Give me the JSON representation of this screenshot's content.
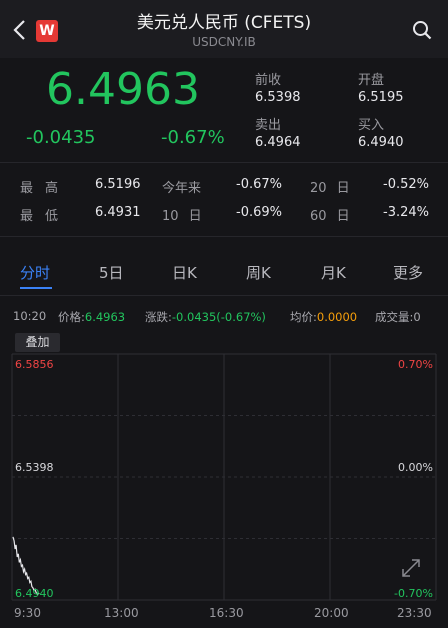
{
  "header": {
    "logo_text": "W",
    "title": "美元兑人民币 (CFETS)",
    "subtitle": "USDCNY.IB"
  },
  "quote": {
    "price": "6.4963",
    "change": "-0.0435",
    "change_pct": "-0.67%",
    "prev_close_label": "前收",
    "prev_close": "6.5398",
    "open_label": "开盘",
    "open": "6.5195",
    "ask_label": "卖出",
    "ask": "6.4964",
    "bid_label": "买入",
    "bid": "6.4940",
    "color_down": "#22c55e"
  },
  "stats": {
    "high_label": "最高",
    "high": "6.5196",
    "ytd_label": "今年来",
    "ytd": "-0.67%",
    "d20_label": "20 日",
    "d20": "-0.52%",
    "low_label": "最低",
    "low": "6.4931",
    "d10_label": "10 日",
    "d10": "-0.69%",
    "d60_label": "60 日",
    "d60": "-3.24%"
  },
  "tabs": [
    "分时",
    "5日",
    "日K",
    "周K",
    "月K",
    "更多"
  ],
  "active_tab": 0,
  "infobar": {
    "time": "10:20",
    "price_label": "价格:",
    "price": "6.4963",
    "change_label": "涨跌:",
    "change": "-0.0435(-0.67%)",
    "avg_label": "均价:",
    "avg": "0.0000",
    "volume_label": "成交量:",
    "volume": "0"
  },
  "overlay_label": "叠加",
  "chart_axis": {
    "top_price": "6.5856",
    "mid_price": "6.5398",
    "bottom_price": "6.4940",
    "top_pct": "0.70%",
    "mid_pct": "0.00%",
    "bottom_pct": "-0.70%",
    "times": [
      "9:30",
      "13:00",
      "16:30",
      "20:00",
      "23:30"
    ]
  },
  "chart_data": {
    "type": "line",
    "title": "",
    "xlabel": "",
    "ylabel": "",
    "ylim": [
      6.494,
      6.5856
    ],
    "x": [
      "9:30",
      "9:32",
      "9:34",
      "9:36",
      "9:38",
      "9:40",
      "9:42",
      "9:44",
      "9:46",
      "9:48",
      "9:50",
      "9:52",
      "9:54",
      "9:56",
      "9:58",
      "10:00",
      "10:02",
      "10:04",
      "10:06",
      "10:08",
      "10:10",
      "10:12",
      "10:14",
      "10:16",
      "10:18",
      "10:20"
    ],
    "series": [
      {
        "values": [
          6.5175,
          6.516,
          6.513,
          6.5145,
          6.51,
          6.5112,
          6.508,
          6.509,
          6.5065,
          6.507,
          6.5045,
          6.5055,
          6.5035,
          6.504,
          6.502,
          6.5025,
          6.5005,
          6.501,
          6.499,
          6.4985,
          6.4975,
          6.498,
          6.4968,
          6.4962,
          6.4965,
          6.4963
        ]
      }
    ],
    "grid": true,
    "colors": {
      "line": "#e8e8ec",
      "grid": "#2e2e34",
      "up": "#ef4444",
      "down": "#22c55e"
    }
  }
}
